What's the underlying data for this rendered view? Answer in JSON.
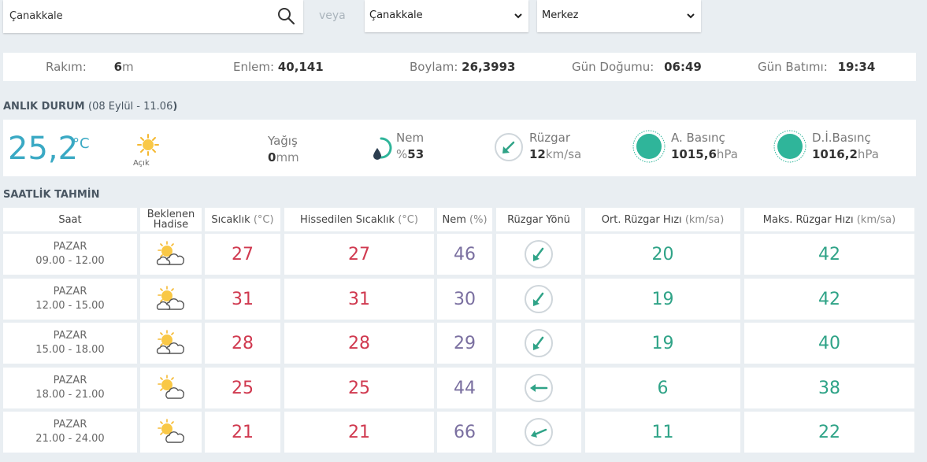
{
  "search": {
    "value": "Çanakkale",
    "or_label": "veya"
  },
  "selects": {
    "province": "Çanakkale",
    "district": "Merkez"
  },
  "info": {
    "altitude_label": "Rakım:",
    "altitude_value": "6",
    "altitude_unit": "m",
    "lat_label": "Enlem:",
    "lat_value": "40,141",
    "lon_label": "Boylam:",
    "lon_value": "26,3993",
    "sunrise_label": "Gün Doğumu:",
    "sunrise_value": "06:49",
    "sunset_label": "Gün Batımı:",
    "sunset_value": "19:34"
  },
  "current": {
    "title": "ANLIK DURUM",
    "date_open": "(",
    "date": "08 Eylül - 11.06",
    "date_close": ")",
    "temperature": "25,2",
    "temp_unit": "°C",
    "condition": "Açık",
    "rain_label": "Yağış",
    "rain_value": "0",
    "rain_unit": "mm",
    "humidity_label": "Nem",
    "humidity_prefix": "%",
    "humidity_value": "53",
    "humidity_fraction": 0.53,
    "wind_label": "Rüzgar",
    "wind_value": "12",
    "wind_unit": "km/sa",
    "pressure_label": "A. Basınç",
    "pressure_value": "1015,6",
    "pressure_unit": "hPa",
    "sea_pressure_label": "D.İ.Basınç",
    "sea_pressure_value": "1016,2",
    "sea_pressure_unit": "hPa"
  },
  "hourly": {
    "title": "SAATLİK TAHMİN",
    "headers": {
      "time": "Saat",
      "event_line1": "Beklenen",
      "event_line2": "Hadise",
      "temp": "Sıcaklık",
      "temp_unit": "(°C)",
      "feels": "Hissedilen Sıcaklık",
      "feels_unit": "(°C)",
      "humidity": "Nem",
      "humidity_unit": "(%)",
      "wind_dir": "Rüzgar Yönü",
      "avg_wind": "Ort. Rüzgar Hızı",
      "avg_wind_unit": "(km/sa)",
      "max_wind": "Maks. Rüzgar Hızı",
      "max_wind_unit": "(km/sa)"
    },
    "rows": [
      {
        "day": "PAZAR",
        "range": "09.00 - 12.00",
        "icon": "partly-cloudy-icon",
        "temp": "27",
        "feels": "27",
        "humidity": "46",
        "wind_icon": "arrow-down-left-icon",
        "avg": "20",
        "max": "42"
      },
      {
        "day": "PAZAR",
        "range": "12.00 - 15.00",
        "icon": "partly-cloudy-icon",
        "temp": "31",
        "feels": "31",
        "humidity": "30",
        "wind_icon": "arrow-down-left-icon",
        "avg": "19",
        "max": "42"
      },
      {
        "day": "PAZAR",
        "range": "15.00 - 18.00",
        "icon": "partly-cloudy-icon",
        "temp": "28",
        "feels": "28",
        "humidity": "29",
        "wind_icon": "arrow-down-left-icon",
        "avg": "19",
        "max": "40"
      },
      {
        "day": "PAZAR",
        "range": "18.00 - 21.00",
        "icon": "sun-cloud-icon",
        "temp": "25",
        "feels": "25",
        "humidity": "44",
        "wind_icon": "arrow-left-icon",
        "avg": "6",
        "max": "38"
      },
      {
        "day": "PAZAR",
        "range": "21.00 - 24.00",
        "icon": "sun-cloud-icon",
        "temp": "21",
        "feels": "21",
        "humidity": "66",
        "wind_icon": "arrow-left-down-icon",
        "avg": "11",
        "max": "22"
      }
    ]
  },
  "colors": {
    "accent": "#3aa9c4",
    "temp_red": "#d0394f",
    "humidity_purple": "#7a6fa0",
    "wind_green": "#2fa387",
    "gauge_teal": "#2fb59a"
  }
}
